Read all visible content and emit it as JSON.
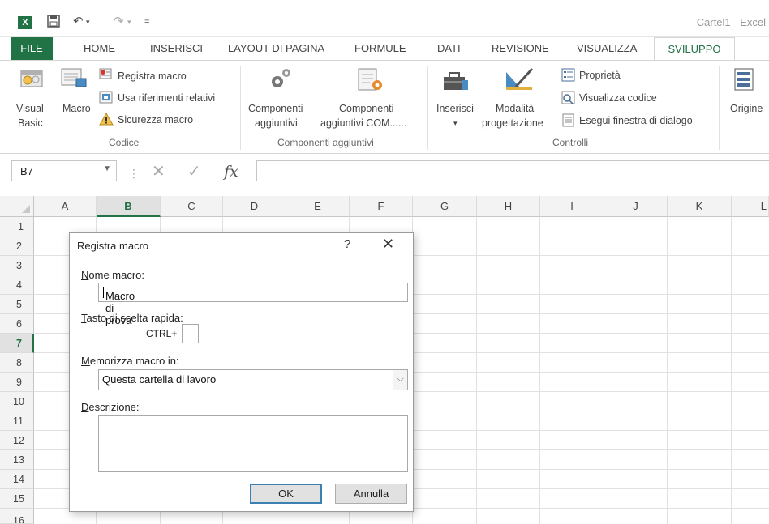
{
  "title_bar": {
    "doc_title": "Cartel1 - Excel",
    "app_icon_label": "X",
    "save_icon": "save-icon",
    "undo_icon": "undo-icon",
    "redo_icon": "redo-icon"
  },
  "tabs": [
    "FILE",
    "HOME",
    "INSERISCI",
    "LAYOUT DI PAGINA",
    "FORMULE",
    "DATI",
    "REVISIONE",
    "VISUALIZZA",
    "SVILUPPO"
  ],
  "active_tab": "SVILUPPO",
  "ribbon": {
    "codice": {
      "label": "Codice",
      "visual_basic": [
        "Visual",
        "Basic"
      ],
      "macro": "Macro",
      "registra_macro": "Registra macro",
      "usa_riferimenti": "Usa riferimenti relativi",
      "sicurezza_macro": "Sicurezza macro"
    },
    "componenti": {
      "label": "Componenti aggiuntivi",
      "componenti_aggiuntivi": [
        "Componenti",
        "aggiuntivi"
      ],
      "componenti_com": [
        "Componenti",
        "aggiuntivi COM......"
      ]
    },
    "controlli": {
      "label": "Controlli",
      "inserisci": "Inserisci",
      "modalita": [
        "Modalità",
        "progettazione"
      ],
      "proprieta": "Proprietà",
      "visualizza_codice": "Visualizza codice",
      "esegui_finestra": "Esegui finestra di dialogo"
    },
    "xml": {
      "origine": "Origine"
    }
  },
  "formula_bar": {
    "name_box": "B7",
    "fx_label": "fx",
    "value": ""
  },
  "grid": {
    "columns": [
      "A",
      "B",
      "C",
      "D",
      "E",
      "F",
      "G",
      "H",
      "I",
      "J",
      "K",
      "L"
    ],
    "rows": [
      "1",
      "2",
      "3",
      "4",
      "5",
      "6",
      "7",
      "8",
      "9",
      "10",
      "11",
      "12",
      "13",
      "14",
      "15",
      "16"
    ],
    "selected_column": "B",
    "selected_row": "7"
  },
  "dialog": {
    "title": "Registra macro",
    "help": "?",
    "nome_macro_label_key": "N",
    "nome_macro_label_rest": "ome macro:",
    "nome_macro_value": "Macro di prova",
    "tasto_label_key": "T",
    "tasto_label_rest": "asto di scelta rapida:",
    "ctrl_label": "CTRL+",
    "ctrl_value": "",
    "memorizza_label_key": "M",
    "memorizza_label_rest": "emorizza macro in:",
    "memorizza_value": "Questa cartella di lavoro",
    "descrizione_label_key": "D",
    "descrizione_label_rest": "escrizione:",
    "descrizione_value": "",
    "ok": "OK",
    "annulla": "Annulla"
  },
  "colors": {
    "excel_green": "#217346",
    "selection_green": "#217346",
    "button_blue": "#3c7fb1"
  }
}
